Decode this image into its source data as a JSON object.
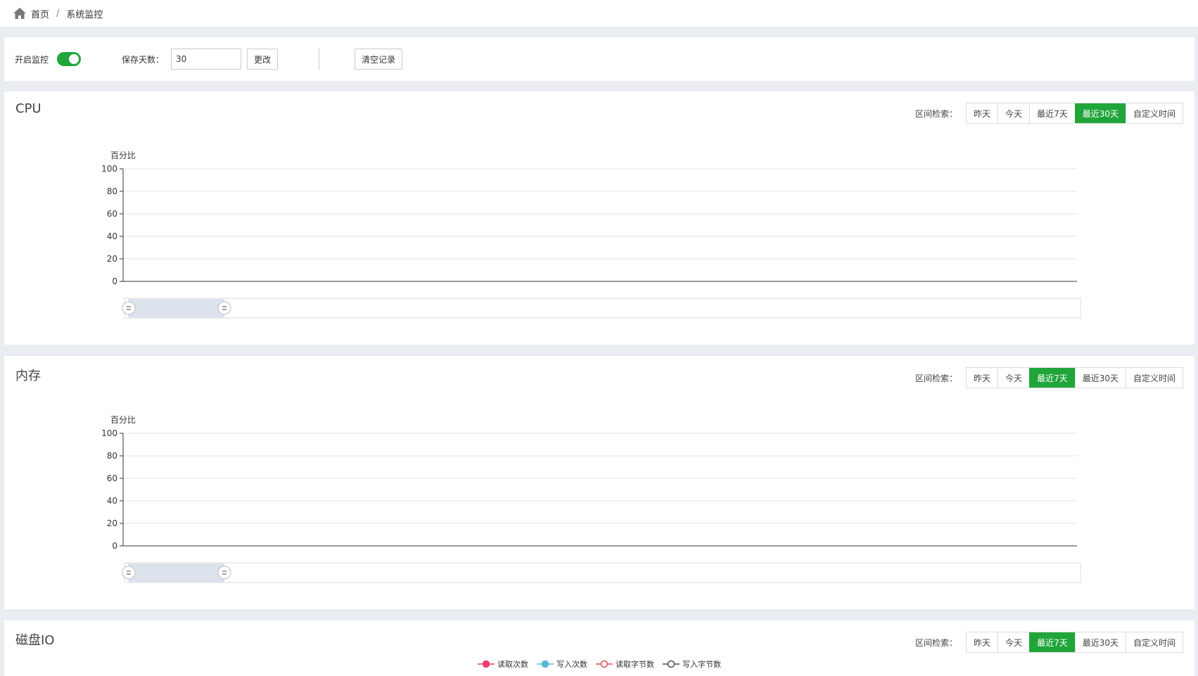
{
  "breadcrumb": {
    "home": "首页",
    "separator": "/",
    "current": "系统监控"
  },
  "toolbar": {
    "monitor_label": "开启监控",
    "monitor_on": true,
    "days_label": "保存天数：",
    "days_value": "30",
    "change_label": "更改",
    "clear_label": "清空记录"
  },
  "range_label": "区间检索：",
  "range_options": [
    "昨天",
    "今天",
    "最近7天",
    "最近30天",
    "自定义时间"
  ],
  "panels": [
    {
      "title": "CPU",
      "active": "最近30天"
    },
    {
      "title": "内存",
      "active": "最近7天"
    },
    {
      "title": "磁盘IO",
      "active": "最近7天"
    }
  ],
  "legend": [
    {
      "label": "读取次数",
      "color": "#ee3d6e",
      "filled": true
    },
    {
      "label": "写入次数",
      "color": "#5bb7ce",
      "filled": true
    },
    {
      "label": "读取字节数",
      "color": "#e04a5a",
      "filled": false
    },
    {
      "label": "写入字节数",
      "color": "#4a4f58",
      "filled": false
    }
  ],
  "chart_data": [
    {
      "type": "line",
      "title": "",
      "ylabel": "百分比",
      "ylim": [
        0,
        100
      ],
      "yticks": [
        "100",
        "80",
        "60",
        "40",
        "20",
        "0"
      ],
      "series": [],
      "grid": true,
      "zoom_slider": true
    },
    {
      "type": "line",
      "title": "",
      "ylabel": "百分比",
      "ylim": [
        0,
        100
      ],
      "yticks": [
        "100",
        "80",
        "60",
        "40",
        "20",
        "0"
      ],
      "series": [],
      "grid": true,
      "zoom_slider": true
    }
  ],
  "colors": {
    "accent": "#20a53a",
    "grid": "#e6e6e6",
    "axis": "#333333",
    "slider": "#dde3ec"
  }
}
